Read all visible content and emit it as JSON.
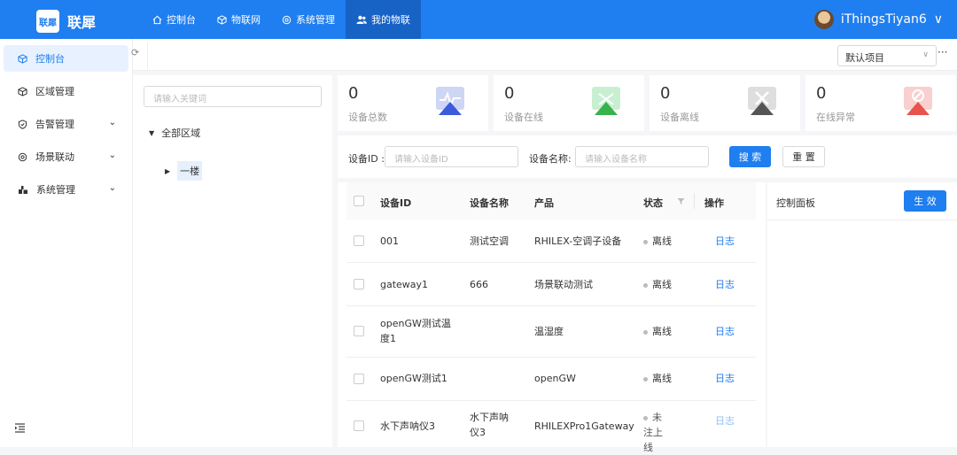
{
  "app": {
    "logo_text": "联犀",
    "brand": "联犀"
  },
  "topnav": [
    {
      "icon": "home-icon",
      "label": "控制台",
      "active": false
    },
    {
      "icon": "cube-icon",
      "label": "物联网",
      "active": false
    },
    {
      "icon": "settings-icon",
      "label": "系统管理",
      "active": false
    },
    {
      "icon": "user-group-icon",
      "label": "我的物联",
      "active": true
    }
  ],
  "user": {
    "name": "iThingsTiyan6",
    "caret": "∨"
  },
  "sidebar": {
    "items": [
      {
        "icon": "cube-icon",
        "label": "控制台",
        "active": true,
        "caret": ""
      },
      {
        "icon": "cube-icon",
        "label": "区域管理",
        "active": false,
        "caret": ""
      },
      {
        "icon": "shield-icon",
        "label": "告警管理",
        "active": false,
        "caret": "⌄"
      },
      {
        "icon": "gear-icon",
        "label": "场景联动",
        "active": false,
        "caret": "⌄"
      },
      {
        "icon": "apps-icon",
        "label": "系统管理",
        "active": false,
        "caret": "⌄"
      }
    ],
    "collapse_icon": "menu-fold-icon"
  },
  "tabs": {
    "refresh_glyph": "⟳",
    "project_select": "默认项目",
    "more": "···"
  },
  "tree": {
    "search_placeholder": "请输入关键词",
    "root": "全部区域",
    "child": "一楼"
  },
  "stats": [
    {
      "value": "0",
      "label": "设备总数",
      "color": "#3b5bdb"
    },
    {
      "value": "0",
      "label": "设备在线",
      "color": "#37b24d"
    },
    {
      "value": "0",
      "label": "设备离线",
      "color": "#555555"
    },
    {
      "value": "0",
      "label": "在线异常",
      "color": "#e8534b"
    }
  ],
  "filter": {
    "device_id_label": "设备ID :",
    "device_id_placeholder": "请输入设备ID",
    "device_name_label": "设备名称:",
    "device_name_placeholder": "请输入设备名称",
    "search_button": "搜 索",
    "reset_button": "重 置"
  },
  "table": {
    "columns": [
      "设备ID",
      "设备名称",
      "产品",
      "状态",
      "操作"
    ],
    "rows": [
      {
        "id": "001",
        "name": "测试空调",
        "product": "RHILEX-空调子设备",
        "status": "离线",
        "action": "日志"
      },
      {
        "id": "gateway1",
        "name": "666",
        "product": "场景联动测试",
        "status": "离线",
        "action": "日志"
      },
      {
        "id": "openGW测试温度1",
        "name": "",
        "product": "温湿度",
        "status": "离线",
        "action": "日志"
      },
      {
        "id": "openGW测试1",
        "name": "",
        "product": "openGW",
        "status": "离线",
        "action": "日志"
      },
      {
        "id": "水下声呐仪3",
        "name": "水下声呐仪3",
        "product": "RHILEXPro1Gateway",
        "status": "未注上线",
        "action": "日志"
      }
    ]
  },
  "control_panel": {
    "title": "控制面板",
    "apply_button": "生 效"
  }
}
